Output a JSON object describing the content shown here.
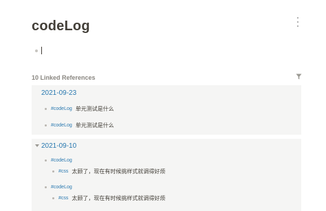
{
  "page": {
    "title": "codeLog"
  },
  "references": {
    "header": "10 Linked References",
    "groups": [
      {
        "date": "2021-09-23",
        "collapsed": false,
        "items": [
          {
            "tag": "#codeLog",
            "text": "单元测试是什么"
          },
          {
            "tag": "#codeLog",
            "text": "单元测试是什么"
          }
        ]
      },
      {
        "date": "2021-09-10",
        "collapsed": false,
        "items": [
          {
            "tag": "#codeLog",
            "child_tag": "#css",
            "child_text": "太顾了，现在有时候挑样式就调得好烦"
          },
          {
            "tag": "#codeLog",
            "child_tag": "#css",
            "child_text": "太顾了，现在有时候挑样式就调得好烦"
          }
        ]
      }
    ]
  },
  "colors": {
    "link": "#2a79b0",
    "text": "#433f38",
    "panel": "#f5f5f4"
  },
  "icons": [
    "more-vertical-icon",
    "filter-icon",
    "chevron-down-icon"
  ]
}
